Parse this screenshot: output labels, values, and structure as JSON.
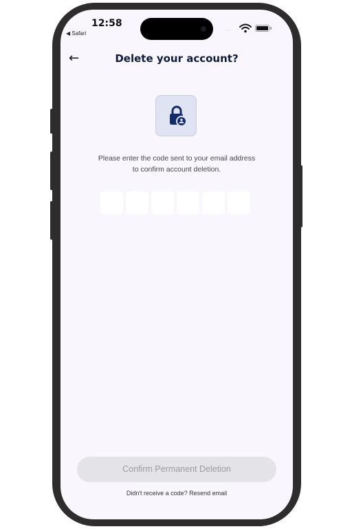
{
  "status_bar": {
    "time": "12:58",
    "back_app": "◀ Safari",
    "signal": "····"
  },
  "header": {
    "back_icon": "←",
    "title": "Delete your account?"
  },
  "icon": {
    "name": "lock-icon",
    "tile_color": "#dfe3f2",
    "glyph_color": "#132a6b"
  },
  "instructions": {
    "line1": "Please enter the code sent to your email address",
    "line2": "to confirm account deletion."
  },
  "code_input": {
    "digits": [
      "",
      "",
      "",
      "",
      "",
      ""
    ]
  },
  "confirm_button": {
    "label": "Confirm Permanent Deletion",
    "enabled": false
  },
  "resend": {
    "prompt": "Didn't receive a code?",
    "link_label": "Resend email"
  },
  "colors": {
    "title": "#0e1b3d",
    "background": "#f9f7fd",
    "button_disabled_bg": "#e4e3e8",
    "button_disabled_text": "#9c9ba2",
    "device_frame": "#2f2c2e"
  }
}
